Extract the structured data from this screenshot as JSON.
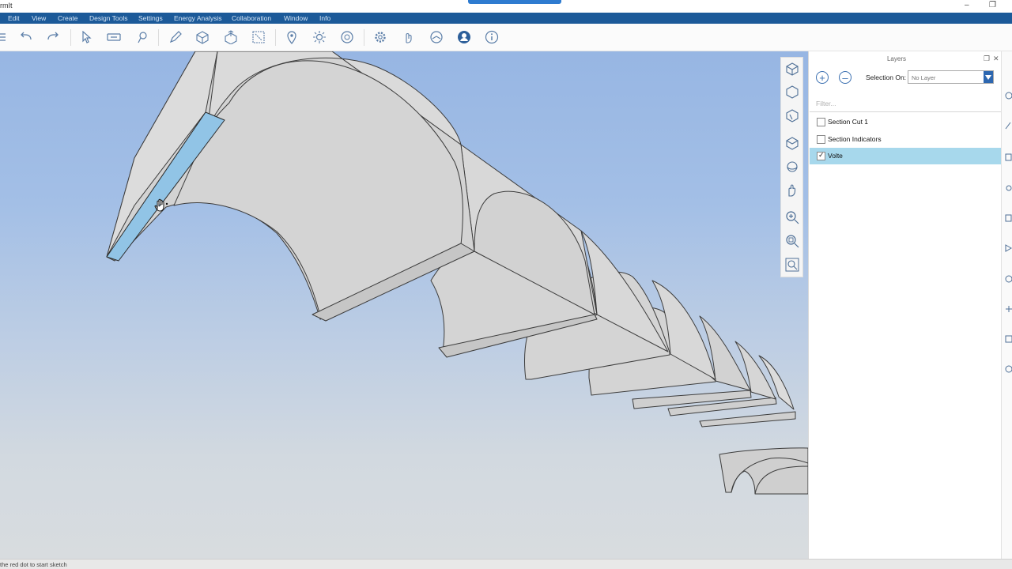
{
  "app": {
    "title_fragment": "rmIt"
  },
  "menu": [
    "Edit",
    "View",
    "Create",
    "Design Tools",
    "Settings",
    "Energy Analysis",
    "Collaboration",
    "Window",
    "Info"
  ],
  "toolbar_icons": [
    "menu-icon",
    "undo-icon",
    "redo-icon",
    "select-icon",
    "measure-icon",
    "paint-bucket-icon",
    "pencil-icon",
    "push-pull-icon",
    "extrude-icon",
    "transform-icon",
    "location-pin-icon",
    "sun-icon",
    "3d-settings-icon",
    "gear-icon",
    "gesture-icon",
    "share-icon",
    "account-icon",
    "info-icon"
  ],
  "view_tools": [
    "cube-top-icon",
    "cube-iso-icon",
    "cube-section-icon",
    "perspective-icon",
    "orbit-icon",
    "pan-icon",
    "zoom-in-icon",
    "zoom-window-icon",
    "zoom-extents-icon"
  ],
  "layers": {
    "title": "Layers",
    "selection_on_label": "Selection On:",
    "selection_value": "No Layer",
    "filter_placeholder": "Filter...",
    "items": [
      {
        "name": "Section Cut  1",
        "checked": false,
        "selected": false
      },
      {
        "name": "Section Indicators",
        "checked": false,
        "selected": false
      },
      {
        "name": "Volte",
        "checked": true,
        "selected": true
      }
    ]
  },
  "status": {
    "text": "the red dot to start sketch"
  },
  "colors": {
    "menubar": "#1c5a99",
    "accent": "#2e7bd0",
    "selection": "#a7d8ec",
    "model_face": "#d4d4d4",
    "highlight_face": "#91c4e6"
  }
}
